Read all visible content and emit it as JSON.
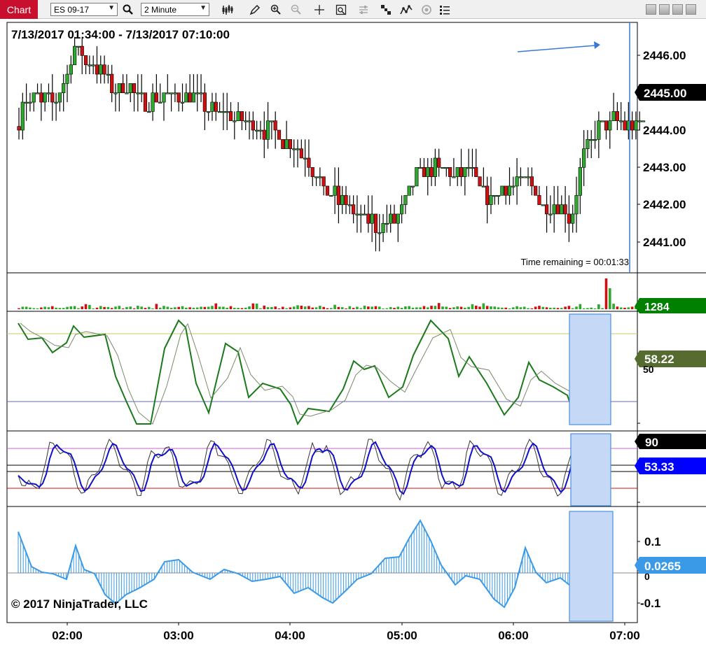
{
  "toolbar": {
    "chart_tab": "Chart",
    "instrument": "ES 09-17",
    "interval": "2 Minute"
  },
  "price_panel": {
    "date_range": "7/13/2017 01:34:00 - 7/13/2017 07:10:00",
    "time_remaining": "Time remaining = 00:01:33",
    "axis_ticks": [
      "2446.00",
      "2444.00",
      "2443.00",
      "2442.00",
      "2441.00"
    ],
    "last_price_label": "2445.00",
    "last_price_color": "#000000"
  },
  "volume_panel": {
    "last_volume_label": "1284",
    "label_color": "#008000"
  },
  "rsi_panel": {
    "value_label": "58.22",
    "partial_tick": "50",
    "label_color": "#556b2f"
  },
  "stoch_panel": {
    "upper_label": "90",
    "value_label": "53.33",
    "value_color": "#0000ff"
  },
  "osc_panel": {
    "ticks": [
      "0.1",
      "0",
      "-0.1"
    ],
    "value_label": "0.0265",
    "value_color": "#3a9ae8"
  },
  "copyright": "© 2017 NinjaTrader, LLC",
  "time_axis": [
    "02:00",
    "03:00",
    "04:00",
    "05:00",
    "06:00",
    "07:00"
  ],
  "chart_data": [
    {
      "type": "candlestick",
      "panel": "price",
      "ylim": [
        2440.3,
        2446.9
      ],
      "description": "2-minute ES 09-17 bars from 01:34 to 07:10",
      "close_path": [
        [
          1.57,
          2444.9
        ],
        [
          1.72,
          2444.8
        ],
        [
          1.87,
          2444.7
        ],
        [
          1.97,
          2445.2
        ],
        [
          2.05,
          2446.2
        ],
        [
          2.15,
          2445.9
        ],
        [
          2.25,
          2445.7
        ],
        [
          2.4,
          2445.2
        ],
        [
          2.55,
          2445.1
        ],
        [
          2.7,
          2444.8
        ],
        [
          2.85,
          2444.9
        ],
        [
          3.0,
          2444.9
        ],
        [
          3.15,
          2444.8
        ],
        [
          3.3,
          2444.6
        ],
        [
          3.45,
          2444.4
        ],
        [
          3.6,
          2444.2
        ],
        [
          3.75,
          2444.0
        ],
        [
          3.9,
          2443.9
        ],
        [
          4.0,
          2443.6
        ],
        [
          4.1,
          2443.4
        ],
        [
          4.2,
          2443.0
        ],
        [
          4.3,
          2442.4
        ],
        [
          4.45,
          2442.1
        ],
        [
          4.6,
          2441.7
        ],
        [
          4.75,
          2441.5
        ],
        [
          4.9,
          2441.5
        ],
        [
          5.0,
          2441.9
        ],
        [
          5.1,
          2442.6
        ],
        [
          5.2,
          2443.0
        ],
        [
          5.35,
          2442.9
        ],
        [
          5.5,
          2442.7
        ],
        [
          5.6,
          2443.0
        ],
        [
          5.7,
          2442.5
        ],
        [
          5.8,
          2442.2
        ],
        [
          5.95,
          2442.5
        ],
        [
          6.1,
          2442.7
        ],
        [
          6.2,
          2442.3
        ],
        [
          6.3,
          2441.9
        ],
        [
          6.4,
          2442.0
        ],
        [
          6.52,
          2441.6
        ],
        [
          6.62,
          2443.2
        ],
        [
          6.75,
          2444.0
        ],
        [
          6.9,
          2444.3
        ],
        [
          7.0,
          2444.1
        ]
      ]
    },
    {
      "type": "bar",
      "panel": "volume",
      "last_value": 1284
    },
    {
      "type": "line",
      "panel": "rsi",
      "series": [
        {
          "name": "",
          "last_value": 58.22
        }
      ]
    },
    {
      "type": "line",
      "panel": "stochastics",
      "levels": [
        90
      ],
      "series": [
        {
          "name": "",
          "last_value": 53.33
        }
      ]
    },
    {
      "type": "area",
      "panel": "oscillator",
      "ylim": [
        -0.16,
        0.16
      ],
      "series": [
        {
          "name": "",
          "last_value": 0.0265
        }
      ]
    }
  ]
}
